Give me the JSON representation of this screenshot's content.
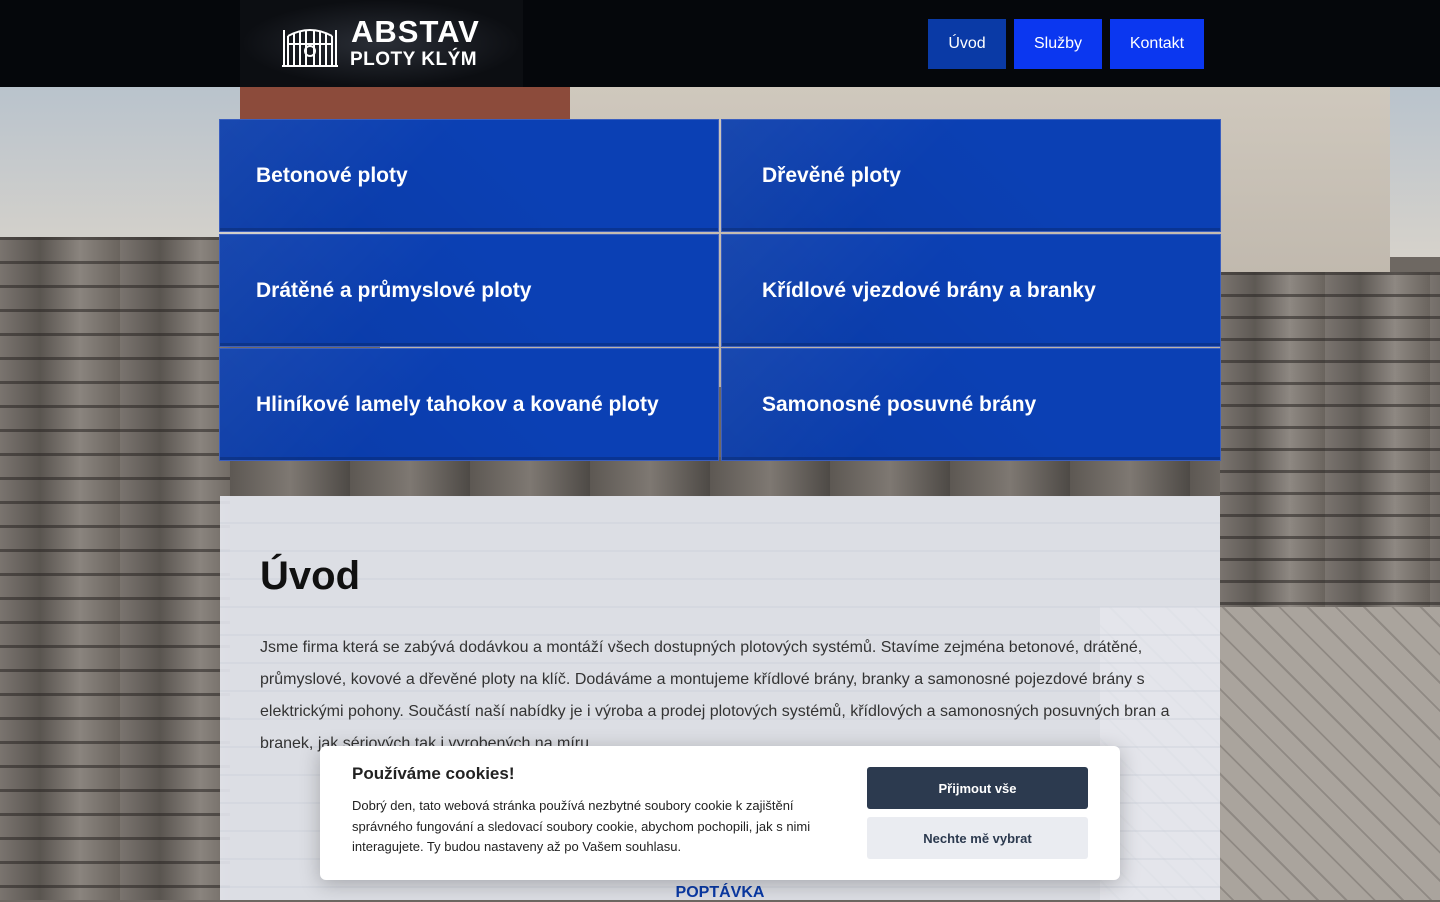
{
  "header": {
    "logo_title": "ABSTAV",
    "logo_subtitle": "PLOTY KLÝM",
    "nav": [
      {
        "label": "Úvod",
        "active": true
      },
      {
        "label": "Služby",
        "active": false
      },
      {
        "label": "Kontakt",
        "active": false
      }
    ]
  },
  "categories": [
    {
      "label": "Betonové ploty"
    },
    {
      "label": "Dřevěné ploty"
    },
    {
      "label": "Drátěné a průmyslové ploty"
    },
    {
      "label": "Křídlové vjezdové brány a branky"
    },
    {
      "label": "Hliníkové lamely tahokov a kované ploty"
    },
    {
      "label": "Samonosné posuvné brány"
    }
  ],
  "intro": {
    "heading": "Úvod",
    "text": "Jsme firma která se zabývá dodávkou a montáží všech dostupných plotových systémů. Stavíme zejména betonové, drátěné, průmyslové, kovové a dřevěné ploty na klíč. Dodáváme a montujeme křídlové brány, branky a samonosné pojezdové brány s elektrickými pohony. Součástí naší nabídky je i výroba a prodej plotových systémů, křídlových a samonosných posuvných  bran a branek, jak sériových tak i vyrobených na míru.",
    "cta": "POPTÁVKA"
  },
  "cookie": {
    "title": "Používáme cookies!",
    "text": "Dobrý den, tato webová stránka používá nezbytné soubory cookie k zajištění správného fungování a sledovací soubory cookie, abychom pochopili, jak s nimi interagujete. Ty budou nastaveny až po Vašem souhlasu.",
    "accept_label": "Přijmout vše",
    "choose_label": "Nechte mě vybrat"
  },
  "colors": {
    "header_bg": "#05070b",
    "nav_active": "#0a3aa6",
    "nav_button": "#0b37f0",
    "tile_blue": "#0b40b4",
    "cookie_accept": "#2c3a4f"
  },
  "icons": {
    "logo": "gate-icon"
  }
}
